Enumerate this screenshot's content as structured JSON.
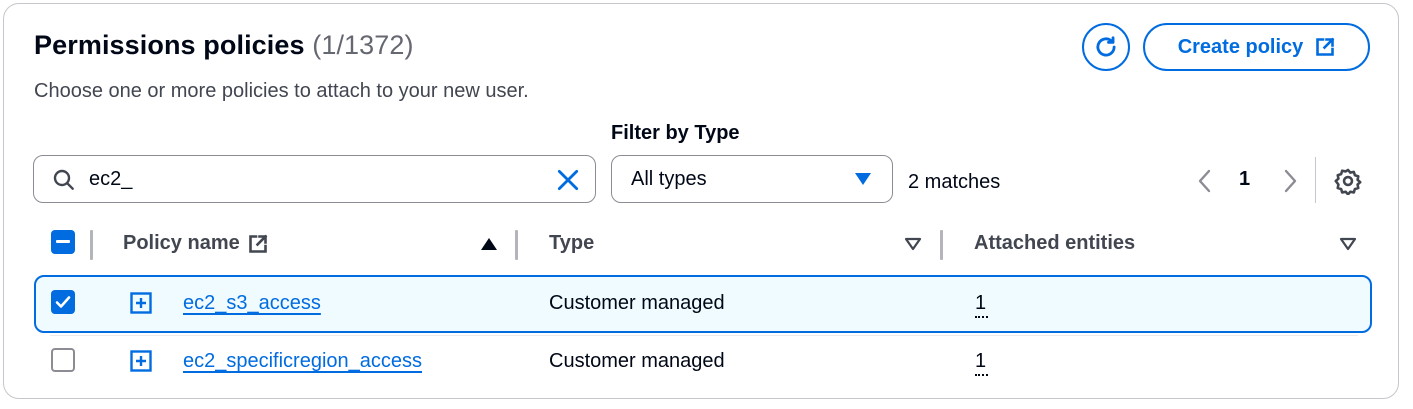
{
  "header": {
    "title": "Permissions policies",
    "count": "(1/1372)",
    "description": "Choose one or more policies to attach to your new user.",
    "create_label": "Create policy"
  },
  "filters": {
    "search_value": "ec2_",
    "type_label": "Filter by Type",
    "type_value": "All types",
    "matches": "2 matches"
  },
  "pagination": {
    "current_page": "1"
  },
  "table": {
    "columns": [
      "Policy name",
      "Type",
      "Attached entities"
    ],
    "rows": [
      {
        "name": "ec2_s3_access",
        "type": "Customer managed",
        "attached": "1",
        "selected": true
      },
      {
        "name": "ec2_specificregion_access",
        "type": "Customer managed",
        "attached": "1",
        "selected": false
      }
    ]
  },
  "colors": {
    "accent": "#006ce0",
    "selected_bg": "#f0fbff",
    "border": "#c6c6cd"
  }
}
